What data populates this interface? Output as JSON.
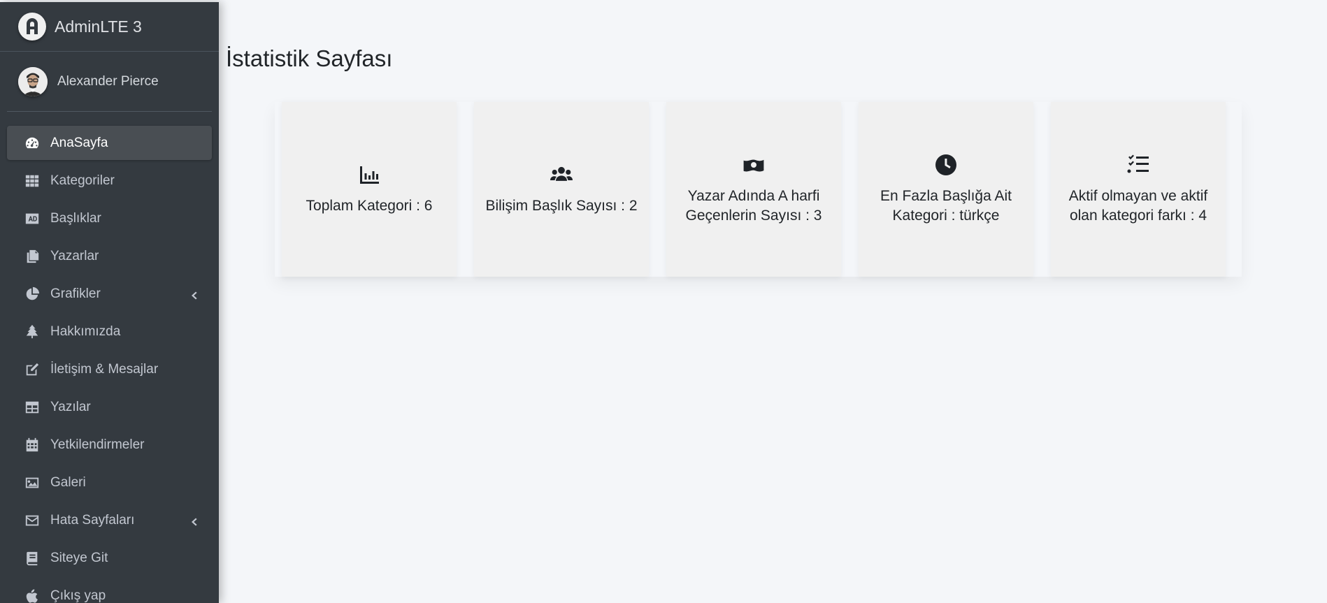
{
  "brand": {
    "name": "AdminLTE 3",
    "logo_letter": "A"
  },
  "user": {
    "name": "Alexander Pierce"
  },
  "sidebar": {
    "items": [
      {
        "label": "AnaSayfa",
        "icon": "tachometer-icon",
        "active": true
      },
      {
        "label": "Kategoriler",
        "icon": "grid-icon"
      },
      {
        "label": "Başlıklar",
        "icon": "ad-icon"
      },
      {
        "label": "Yazarlar",
        "icon": "copy-icon"
      },
      {
        "label": "Grafikler",
        "icon": "pie-chart-icon",
        "has_submenu": true
      },
      {
        "label": "Hakkımızda",
        "icon": "tree-icon"
      },
      {
        "label": "İletişim & Mesajlar",
        "icon": "edit-icon"
      },
      {
        "label": "Yazılar",
        "icon": "table-icon"
      },
      {
        "label": "Yetkilendirmeler",
        "icon": "calendar-icon"
      },
      {
        "label": "Galeri",
        "icon": "image-icon"
      },
      {
        "label": "Hata Sayfaları",
        "icon": "envelope-icon",
        "has_submenu": true
      },
      {
        "label": "Siteye Git",
        "icon": "book-icon"
      },
      {
        "label": "Çıkış yap",
        "icon": "apple-icon"
      }
    ]
  },
  "main": {
    "title": "İstatistik Sayfası",
    "cards": [
      {
        "icon": "bar-chart-icon",
        "line1": "Toplam Kategori : 6",
        "line2": ""
      },
      {
        "icon": "users-icon",
        "line1": "Bilişim Başlık Sayısı : 2",
        "line2": ""
      },
      {
        "icon": "money-bill-icon",
        "line1": "Yazar Adında A harfi",
        "line2": "Geçenlerin Sayısı : 3"
      },
      {
        "icon": "clock-icon",
        "line1": "En Fazla Başlığa Ait",
        "line2": "Kategori : türkçe"
      },
      {
        "icon": "list-check-icon",
        "line1": "Aktif olmayan ve aktif",
        "line2": "olan kategori farkı : 4"
      }
    ]
  }
}
